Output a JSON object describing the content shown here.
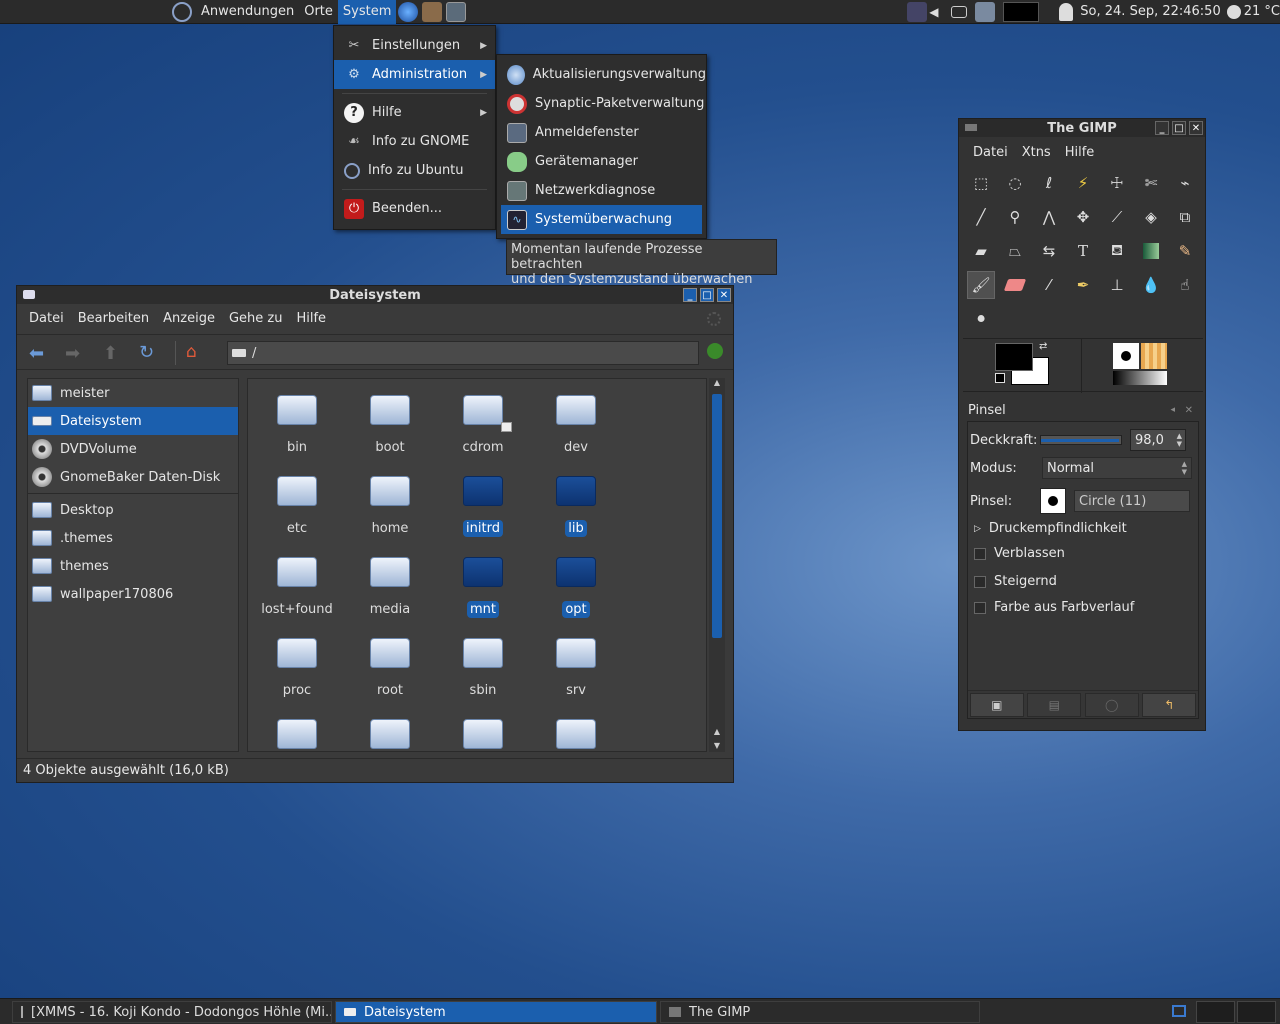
{
  "top_panel": {
    "menus": [
      "Anwendungen",
      "Orte",
      "System"
    ],
    "clock": "So, 24. Sep, 22:46:50",
    "temperature": "21 °C"
  },
  "system_menu": {
    "items": [
      {
        "label": "Einstellungen",
        "icon": "tools-icon",
        "submenu": true
      },
      {
        "label": "Administration",
        "icon": "gear-icon",
        "submenu": true
      },
      {
        "label": "Hilfe",
        "icon": "help-icon",
        "submenu": true
      },
      {
        "label": "Info zu GNOME",
        "icon": "gnome-icon",
        "submenu": false
      },
      {
        "label": "Info zu Ubuntu",
        "icon": "ubuntu-icon",
        "submenu": false
      },
      {
        "label": "Beenden...",
        "icon": "power-icon",
        "submenu": false
      }
    ]
  },
  "admin_menu": {
    "items": [
      "Aktualisierungsverwaltung",
      "Synaptic-Paketverwaltung",
      "Anmeldefenster",
      "Gerätemanager",
      "Netzwerkdiagnose",
      "Systemüberwachung"
    ],
    "tooltip_line1": "Momentan laufende Prozesse betrachten",
    "tooltip_line2": "und den Systemzustand überwachen"
  },
  "file_manager": {
    "title": "Dateisystem",
    "menus": [
      "Datei",
      "Bearbeiten",
      "Anzeige",
      "Gehe zu",
      "Hilfe"
    ],
    "location": "/",
    "sidebar": [
      {
        "label": "meister",
        "type": "home"
      },
      {
        "label": "Dateisystem",
        "type": "drive",
        "selected": true
      },
      {
        "label": "DVDVolume",
        "type": "disc"
      },
      {
        "label": "GnomeBaker Daten-Disk",
        "type": "disc"
      },
      {
        "label": "Desktop",
        "type": "folder"
      },
      {
        "label": ".themes",
        "type": "folder"
      },
      {
        "label": "themes",
        "type": "folder"
      },
      {
        "label": "wallpaper170806",
        "type": "folder"
      }
    ],
    "folders": [
      {
        "name": "bin",
        "selected": false
      },
      {
        "name": "boot",
        "selected": false
      },
      {
        "name": "cdrom",
        "selected": false
      },
      {
        "name": "dev",
        "selected": false
      },
      {
        "name": "etc",
        "selected": false
      },
      {
        "name": "home",
        "selected": false
      },
      {
        "name": "initrd",
        "selected": true
      },
      {
        "name": "lib",
        "selected": true
      },
      {
        "name": "lost+found",
        "selected": false
      },
      {
        "name": "media",
        "selected": false
      },
      {
        "name": "mnt",
        "selected": true
      },
      {
        "name": "opt",
        "selected": true
      },
      {
        "name": "proc",
        "selected": false
      },
      {
        "name": "root",
        "selected": false
      },
      {
        "name": "sbin",
        "selected": false
      },
      {
        "name": "srv",
        "selected": false
      }
    ],
    "status": "4 Objekte ausgewählt (16,0 kB)"
  },
  "gimp": {
    "title": "The GIMP",
    "menus": [
      "Datei",
      "Xtns",
      "Hilfe"
    ],
    "panel_title": "Pinsel",
    "opacity_label": "Deckkraft:",
    "opacity_value": "98,0",
    "opacity_fraction": 0.98,
    "mode_label": "Modus:",
    "mode_value": "Normal",
    "brush_label": "Pinsel:",
    "brush_value": "Circle (11)",
    "options": [
      "Druckempfindlichkeit",
      "Verblassen",
      "Steigernd",
      "Farbe aus Farbverlauf"
    ]
  },
  "taskbar": {
    "tasks": [
      {
        "label": "[XMMS - 16. Koji Kondo - Dodongos Höhle (Mi...",
        "active": false
      },
      {
        "label": "Dateisystem",
        "active": true
      },
      {
        "label": "The GIMP",
        "active": false
      }
    ]
  },
  "colors": {
    "accent": "#1b5fae",
    "panel": "#2b2b2b",
    "window_bg": "#3a3a3a"
  }
}
